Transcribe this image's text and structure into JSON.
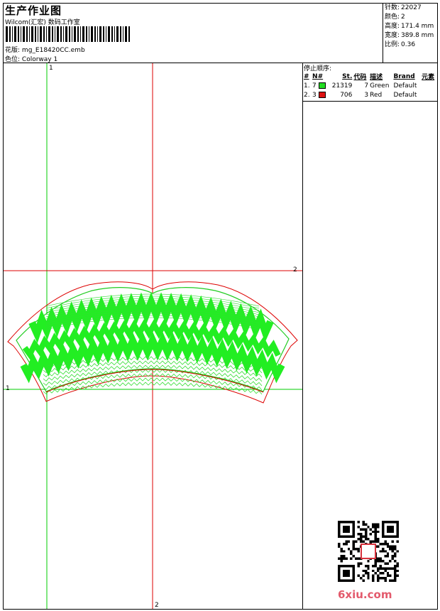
{
  "header": {
    "title": "生产作业图",
    "company": "Wilcom(汇宏) 数码工作室",
    "design_label": "花版:",
    "design_file": "mg_E18420CC.emb",
    "colorway_label": "色位:",
    "colorway": "Colorway 1"
  },
  "stats": [
    {
      "label": "针数:",
      "value": "22027"
    },
    {
      "label": "颜色:",
      "value": "2"
    },
    {
      "label": "高度:",
      "value": "171.4 mm"
    },
    {
      "label": "宽度:",
      "value": "389.8 mm"
    },
    {
      "label": "比例:",
      "value": "0.36"
    }
  ],
  "sequence": {
    "title": "停止顺序:",
    "columns": [
      "#",
      "N#",
      "St.",
      "代码",
      "描述",
      "Brand",
      "元素"
    ],
    "rows": [
      {
        "index": "1.",
        "n": "7",
        "color": "#22dd22",
        "stitches": "21319",
        "code": "7",
        "desc": "Green",
        "brand": "Default",
        "element": ""
      },
      {
        "index": "2.",
        "n": "3",
        "color": "#dd1111",
        "stitches": "706",
        "code": "3",
        "desc": "Red",
        "brand": "Default",
        "element": ""
      }
    ]
  },
  "axes": {
    "v1_label": "1",
    "v2_label": "2",
    "h2_label": "2",
    "h1_label": "1",
    "bottom_label": "2"
  },
  "colors": {
    "guide_green": "#00cc00",
    "guide_red": "#dd0000",
    "fill_green": "#22ee22"
  },
  "watermark": {
    "text": "6xiu.com",
    "stamp_text": "印 鉴"
  }
}
